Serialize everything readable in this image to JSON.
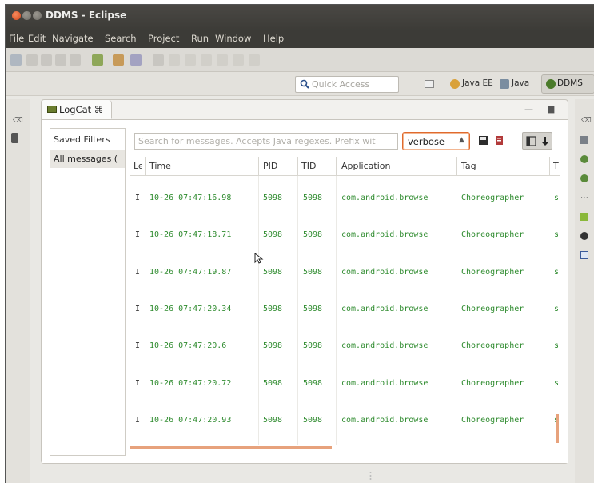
{
  "window": {
    "title": "DDMS - Eclipse"
  },
  "menubar": {
    "items": [
      "File",
      "Edit",
      "Navigate",
      "Search",
      "Project",
      "Run",
      "Window",
      "Help"
    ]
  },
  "perspective_bar": {
    "quick_access_placeholder": "Quick Access",
    "perspectives": [
      "Java EE",
      "Java",
      "DDMS"
    ],
    "active": "DDMS"
  },
  "logcat": {
    "tab_label": "LogCat ⌘",
    "saved_filters_title": "Saved Filters",
    "filters": [
      "All messages ("
    ],
    "search_placeholder": "Search for messages. Accepts Java regexes. Prefix wit",
    "log_level": "verbose",
    "columns": [
      "Le",
      "Time",
      "PID",
      "TID",
      "Application",
      "Tag",
      "T"
    ],
    "rows": [
      {
        "level": "I",
        "time": "10-26 07:47:16.98",
        "pid": "5098",
        "tid": "5098",
        "app": "com.android.browse",
        "tag": "Choreographer",
        "text": "s"
      },
      {
        "level": "I",
        "time": "10-26 07:47:18.71",
        "pid": "5098",
        "tid": "5098",
        "app": "com.android.browse",
        "tag": "Choreographer",
        "text": "s"
      },
      {
        "level": "I",
        "time": "10-26 07:47:19.87",
        "pid": "5098",
        "tid": "5098",
        "app": "com.android.browse",
        "tag": "Choreographer",
        "text": "s"
      },
      {
        "level": "I",
        "time": "10-26 07:47:20.34",
        "pid": "5098",
        "tid": "5098",
        "app": "com.android.browse",
        "tag": "Choreographer",
        "text": "s"
      },
      {
        "level": "I",
        "time": "10-26 07:47:20.6",
        "pid": "5098",
        "tid": "5098",
        "app": "com.android.browse",
        "tag": "Choreographer",
        "text": "s"
      },
      {
        "level": "I",
        "time": "10-26 07:47:20.72",
        "pid": "5098",
        "tid": "5098",
        "app": "com.android.browse",
        "tag": "Choreographer",
        "text": "s"
      },
      {
        "level": "I",
        "time": "10-26 07:47:20.93",
        "pid": "5098",
        "tid": "5098",
        "app": "com.android.browse",
        "tag": "Choreographer",
        "text": "s"
      }
    ]
  },
  "colors": {
    "log_text": "#2e8b2e",
    "accent": "#e06a2e",
    "titlebar": "#3c3b37"
  }
}
